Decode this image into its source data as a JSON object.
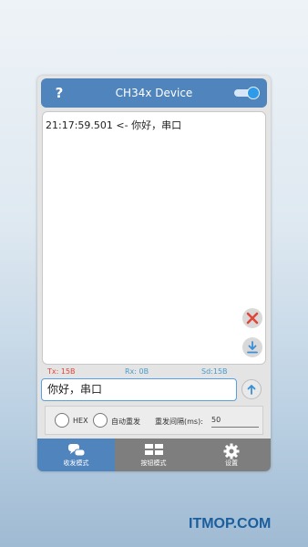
{
  "header": {
    "help_label": "?",
    "title": "CH34x Device",
    "toggle_on": true
  },
  "log": {
    "lines": [
      "21:17:59.501 <- 你好，串口"
    ]
  },
  "counters": {
    "tx": "Tx: 15B",
    "rx": "Rx: 0B",
    "sd": "Sd:15B",
    "tx_color": "#e0463a",
    "rx_color": "#4a9acb",
    "sd_color": "#4a9acb"
  },
  "input": {
    "value": "你好，串口"
  },
  "options": {
    "hex_label": "HEX",
    "auto_resend_label": "自动重发",
    "interval_label": "重发间隔(ms):",
    "interval_value": "50"
  },
  "nav": {
    "items": [
      {
        "label": "收发模式",
        "active": true
      },
      {
        "label": "按钮模式",
        "active": false
      },
      {
        "label": "设置",
        "active": false
      }
    ]
  },
  "watermark": "ITMOP.COM",
  "colors": {
    "accent": "#4f84bd",
    "clear_red": "#e0463a",
    "download_blue": "#3a8fd6"
  }
}
